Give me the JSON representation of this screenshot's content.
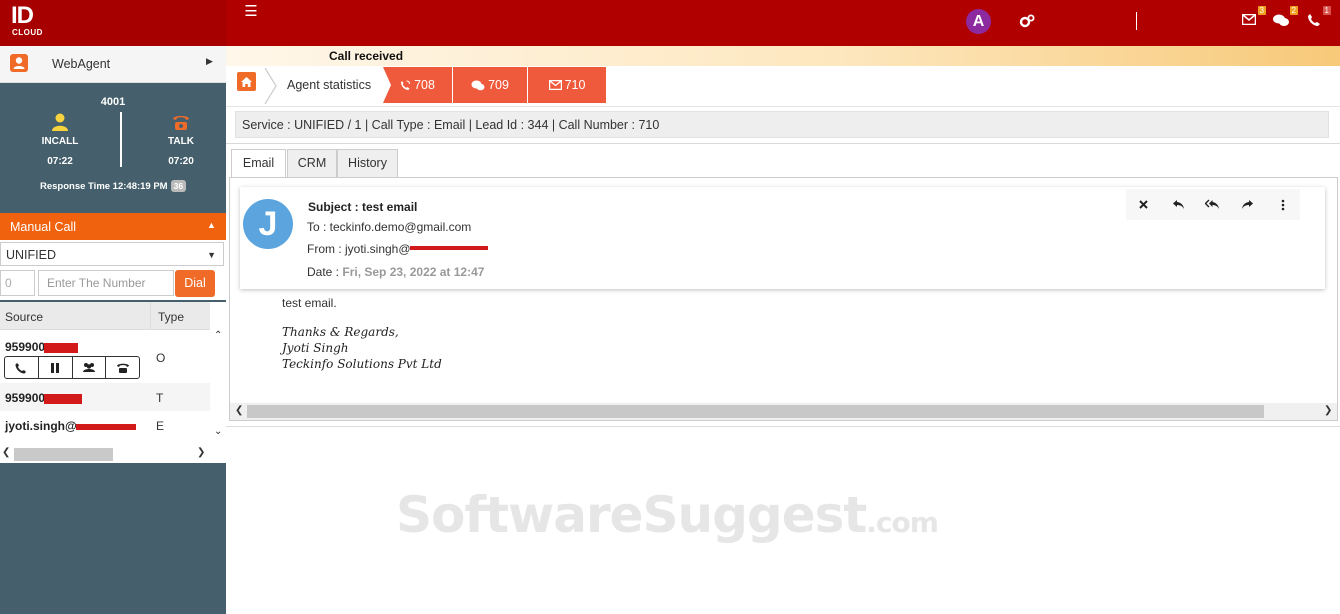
{
  "topbar": {
    "logo_main": "ID",
    "logo_sub": "CLOUD",
    "avatar_letter": "A",
    "badges": {
      "mail": "3",
      "chat": "2",
      "calls": "1"
    }
  },
  "sidebar": {
    "agent_menu_label": "WebAgent",
    "extension": "4001",
    "stats": [
      {
        "label": "INCALL",
        "time": "07:22"
      },
      {
        "label": "TALK",
        "time": "07:20"
      }
    ],
    "response_time": "Response Time 12:48:19 PM",
    "response_badge": "36",
    "manual_call": {
      "title": "Manual Call",
      "service_value": "UNIFIED",
      "prefix_placeholder": "0",
      "number_placeholder": "Enter The Number",
      "dial_label": "Dial"
    },
    "calls_table": {
      "columns": [
        "Source",
        "Type"
      ],
      "rows": [
        {
          "source": "959900",
          "type": "O"
        },
        {
          "source": "959900",
          "type": "T"
        },
        {
          "source": "jyoti.singh@",
          "type": "E"
        }
      ]
    }
  },
  "main": {
    "status_banner": "Call received",
    "breadcrumb": "Agent statistics",
    "call_tabs": [
      {
        "icon": "phone-incoming-icon",
        "label": "708"
      },
      {
        "icon": "chat-icon",
        "label": "709"
      },
      {
        "icon": "envelope-icon",
        "label": "710"
      }
    ],
    "info_bar": "Service : UNIFIED / 1 | Call Type : Email | Lead Id : 344 | Call Number : 710",
    "tabs": [
      "Email",
      "CRM",
      "History"
    ],
    "email": {
      "avatar_letter": "J",
      "subject": "Subject : test email",
      "to": "To : teckinfo.demo@gmail.com",
      "from": "From : jyoti.singh@",
      "date_label": "Date : ",
      "date_value": "Fri, Sep 23, 2022 at 12:47",
      "body": "test email.",
      "signature": [
        "Thanks & Regards,",
        "Jyoti Singh",
        "Teckinfo Solutions Pvt Ltd"
      ]
    },
    "watermark": {
      "main": "SoftwareSuggest",
      "suffix": ".com"
    }
  },
  "colors": {
    "header_red": "#b00000",
    "sidebar_slate": "#45606c",
    "accent_orange": "#f06a28",
    "call_tab_coral": "#f05a3c",
    "avatar_purple": "#8e2aa0",
    "email_avatar_blue": "#5ba4dd"
  }
}
